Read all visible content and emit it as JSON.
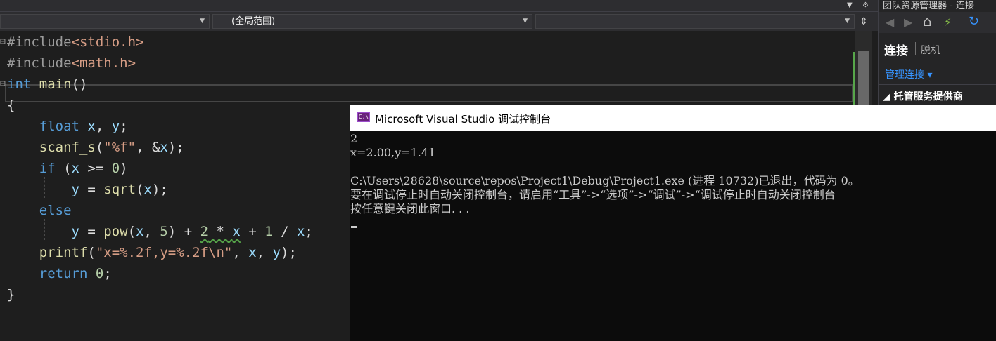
{
  "top_bar": {
    "arrow": "▼",
    "gear": "⚙"
  },
  "nav_bar": {
    "dropdown_project": "",
    "dropdown_scope": "(全局范围)",
    "dropdown_member": "",
    "split_button": "⇕"
  },
  "code_lines": [
    {
      "text": "#include<stdio.h>",
      "fold": "⊟"
    },
    {
      "text": "#include<math.h>",
      "fold": ""
    },
    {
      "text": "int main()",
      "fold": "⊟"
    },
    {
      "text": "{",
      "fold": ""
    },
    {
      "text": "    float x, y;",
      "fold": ""
    },
    {
      "text": "    scanf_s(\"%f\", &x);",
      "fold": ""
    },
    {
      "text": "    if (x >= 0)",
      "fold": ""
    },
    {
      "text": "        y = sqrt(x);",
      "fold": ""
    },
    {
      "text": "    else",
      "fold": ""
    },
    {
      "text": "        y = pow(x, 5) + 2 * x + 1 / x;",
      "fold": ""
    },
    {
      "text": "    printf(\"x=%.2f,y=%.2f\\n\", x, y);",
      "fold": ""
    },
    {
      "text": "    return 0;",
      "fold": ""
    },
    {
      "text": "}",
      "fold": ""
    }
  ],
  "colors": {
    "keyword": "#569cd6",
    "string": "#d69d85",
    "function": "#dcdcaa",
    "identifier": "#9cdcfe",
    "number": "#b5cea8",
    "include": "#9b9b9b",
    "squiggle": "#57a64a"
  },
  "panel": {
    "title": "团队资源管理器 - 连接",
    "connect": "连接",
    "offline": "脱机",
    "manage": "管理连接 ▾",
    "host": "◢ 托管服务提供商",
    "tools": {
      "back": "◀",
      "forward": "▶",
      "home": "⌂",
      "plug": "⚡",
      "refresh": "↻"
    }
  },
  "console": {
    "title": "Microsoft Visual Studio 调试控制台",
    "icon_text": "C:\\",
    "lines": [
      "2",
      "x=2.00,y=1.41",
      "",
      "C:\\Users\\28628\\source\\repos\\Project1\\Debug\\Project1.exe (进程 10732)已退出，代码为 0。",
      "要在调试停止时自动关闭控制台，请启用“工具”->“选项”->“调试”->“调试停止时自动关闭控制台",
      "按任意键关闭此窗口. . ."
    ]
  }
}
